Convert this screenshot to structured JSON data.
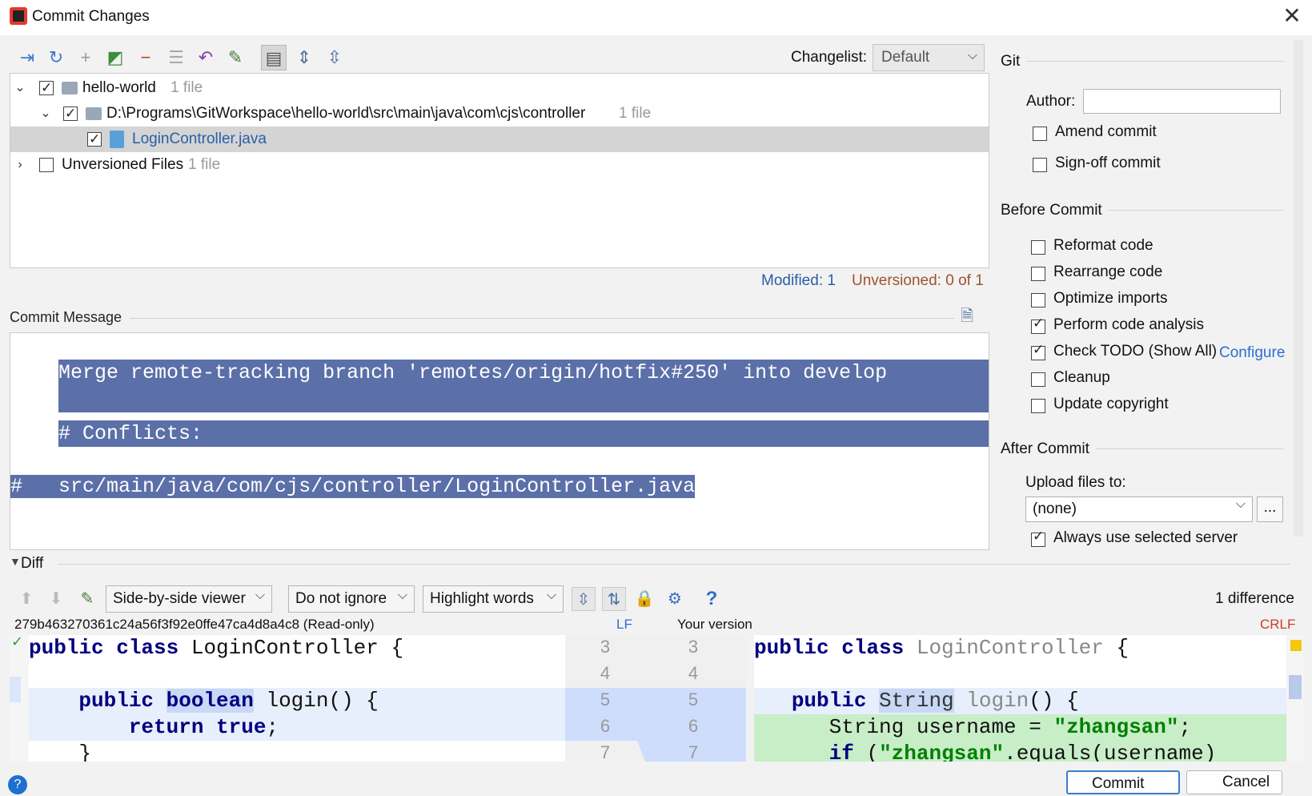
{
  "window": {
    "title": "Commit Changes",
    "close_glyph": "✕"
  },
  "toolbar": {
    "icons": [
      "show-diff-icon",
      "refresh-icon",
      "add-icon",
      "move-icon",
      "remove-icon",
      "group-icon",
      "revert-icon",
      "edit-source-icon",
      "group-by-directory-icon",
      "expand-all-icon",
      "collapse-all-icon"
    ],
    "glyphs": [
      "⇥",
      "↻",
      "+",
      "◩",
      "−",
      "☰",
      "↶",
      "✎",
      "▤",
      "⇕",
      "⇳"
    ],
    "changelist_label": "Changelist:",
    "changelist_value": "Default"
  },
  "tree": {
    "repo_name": "hello-world",
    "repo_count": "1 file",
    "path": "D:\\Programs\\GitWorkspace\\hello-world\\src\\main\\java\\com\\cjs\\controller",
    "path_count": "1 file",
    "file": "LoginController.java",
    "unversioned": "Unversioned Files",
    "unversioned_count": "1 file"
  },
  "status": {
    "modified": "Modified: 1",
    "unversioned": "Unversioned: 0 of 1"
  },
  "commit_message": {
    "label": "Commit Message",
    "lines": [
      "Merge remote-tracking branch 'remotes/origin/hotfix#250' into develop",
      "",
      "# Conflicts:",
      "#\tsrc/main/java/com/cjs/controller/LoginController.java"
    ]
  },
  "git": {
    "section": "Git",
    "author_label": "Author:",
    "author_value": "",
    "amend": "Amend commit",
    "signoff": "Sign-off commit"
  },
  "before_commit": {
    "section": "Before Commit",
    "options": [
      {
        "label": "Reformat code",
        "checked": false
      },
      {
        "label": "Rearrange code",
        "checked": false
      },
      {
        "label": "Optimize imports",
        "checked": false
      },
      {
        "label": "Perform code analysis",
        "checked": true
      },
      {
        "label": "Check TODO (Show All)",
        "checked": true
      },
      {
        "label": "Cleanup",
        "checked": false
      },
      {
        "label": "Update copyright",
        "checked": false
      }
    ],
    "configure_link": "Configure"
  },
  "after_commit": {
    "section": "After Commit",
    "upload_label": "Upload files to:",
    "upload_value": "(none)",
    "upload_browse": "...",
    "always_use": "Always use selected server"
  },
  "diff": {
    "label": "Diff",
    "viewer": "Side-by-side viewer",
    "ignore": "Do not ignore",
    "highlight": "Highlight words",
    "help": "?",
    "differences": "1 difference",
    "left_header": "279b463270361c24a56f3f92e0ffe47ca4d8a4c8 (Read-only)",
    "left_sep": "LF",
    "right_header": "Your version",
    "right_sep": "CRLF",
    "line_numbers": [
      "3",
      "4",
      "5",
      "6",
      "7"
    ]
  },
  "buttons": {
    "commit": "Commit",
    "cancel": "Cancel"
  },
  "colors": {
    "selection": "#5b6fa8",
    "link": "#2a5ea8",
    "changed": "#dbe6fb",
    "added": "#c8eec8"
  }
}
